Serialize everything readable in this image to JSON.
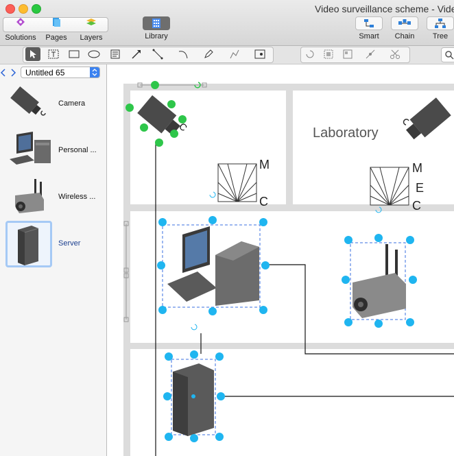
{
  "window": {
    "title": "Video surveillance scheme - Video"
  },
  "toolbar": {
    "solutions": "Solutions",
    "pages": "Pages",
    "layers": "Layers",
    "library": "Library",
    "smart": "Smart",
    "chain": "Chain",
    "tree": "Tree"
  },
  "sidebar": {
    "selector_value": "Untitled 65",
    "items": [
      {
        "label": "Camera",
        "icon": "camera-icon"
      },
      {
        "label": "Personal ...",
        "icon": "computer-icon"
      },
      {
        "label": "Wireless  ...",
        "icon": "wireless-camera-icon"
      },
      {
        "label": "Server",
        "icon": "server-icon",
        "selected": true
      }
    ]
  },
  "canvas": {
    "room_label": "Laboratory",
    "fov_letters_1": {
      "top": "M",
      "bottom": "C"
    },
    "fov_letters_2": {
      "top": "M",
      "middle": "E",
      "bottom": "C"
    },
    "camera_tag": "C"
  },
  "colors": {
    "handle": "#1fb5f0",
    "selected_handle": "#2ec64a",
    "selection_border": "#3a6fe0",
    "accent": "#2a63d6"
  }
}
